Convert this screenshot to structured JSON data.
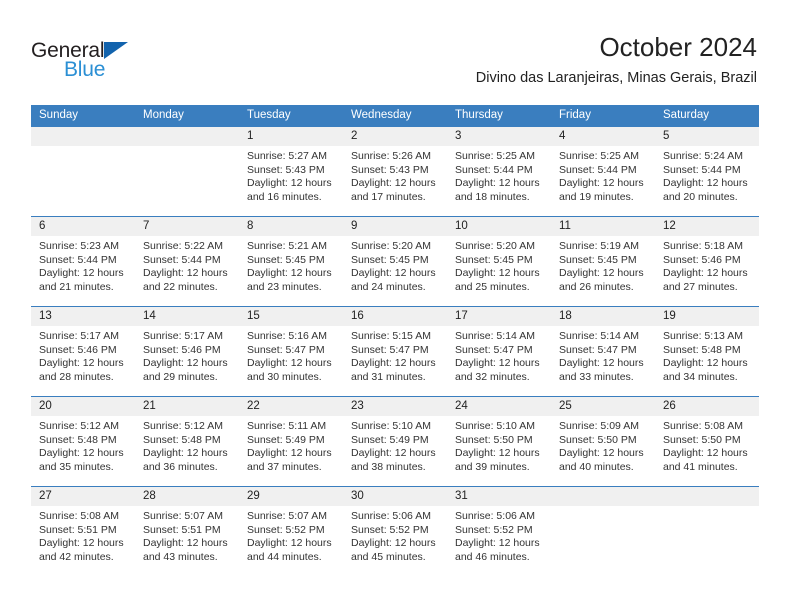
{
  "logo": {
    "word_dark": "General",
    "word_blue": "Blue",
    "triangle_color": "#1263ad",
    "blue_color": "#2b8fd4"
  },
  "header": {
    "title": "October 2024",
    "subtitle": "Divino das Laranjeiras, Minas Gerais, Brazil"
  },
  "theme": {
    "header_blue": "#3a7ebf",
    "band_gray": "#f0f0f0",
    "text": "#333333"
  },
  "calendar": {
    "weekday_headers": [
      "Sunday",
      "Monday",
      "Tuesday",
      "Wednesday",
      "Thursday",
      "Friday",
      "Saturday"
    ],
    "weeks": [
      [
        {
          "day": "",
          "empty": true,
          "sunrise": "",
          "sunset": "",
          "daylight_1": "",
          "daylight_2": ""
        },
        {
          "day": "",
          "empty": true,
          "sunrise": "",
          "sunset": "",
          "daylight_1": "",
          "daylight_2": ""
        },
        {
          "day": "1",
          "sunrise": "Sunrise: 5:27 AM",
          "sunset": "Sunset: 5:43 PM",
          "daylight_1": "Daylight: 12 hours",
          "daylight_2": "and 16 minutes."
        },
        {
          "day": "2",
          "sunrise": "Sunrise: 5:26 AM",
          "sunset": "Sunset: 5:43 PM",
          "daylight_1": "Daylight: 12 hours",
          "daylight_2": "and 17 minutes."
        },
        {
          "day": "3",
          "sunrise": "Sunrise: 5:25 AM",
          "sunset": "Sunset: 5:44 PM",
          "daylight_1": "Daylight: 12 hours",
          "daylight_2": "and 18 minutes."
        },
        {
          "day": "4",
          "sunrise": "Sunrise: 5:25 AM",
          "sunset": "Sunset: 5:44 PM",
          "daylight_1": "Daylight: 12 hours",
          "daylight_2": "and 19 minutes."
        },
        {
          "day": "5",
          "sunrise": "Sunrise: 5:24 AM",
          "sunset": "Sunset: 5:44 PM",
          "daylight_1": "Daylight: 12 hours",
          "daylight_2": "and 20 minutes."
        }
      ],
      [
        {
          "day": "6",
          "sunrise": "Sunrise: 5:23 AM",
          "sunset": "Sunset: 5:44 PM",
          "daylight_1": "Daylight: 12 hours",
          "daylight_2": "and 21 minutes."
        },
        {
          "day": "7",
          "sunrise": "Sunrise: 5:22 AM",
          "sunset": "Sunset: 5:44 PM",
          "daylight_1": "Daylight: 12 hours",
          "daylight_2": "and 22 minutes."
        },
        {
          "day": "8",
          "sunrise": "Sunrise: 5:21 AM",
          "sunset": "Sunset: 5:45 PM",
          "daylight_1": "Daylight: 12 hours",
          "daylight_2": "and 23 minutes."
        },
        {
          "day": "9",
          "sunrise": "Sunrise: 5:20 AM",
          "sunset": "Sunset: 5:45 PM",
          "daylight_1": "Daylight: 12 hours",
          "daylight_2": "and 24 minutes."
        },
        {
          "day": "10",
          "sunrise": "Sunrise: 5:20 AM",
          "sunset": "Sunset: 5:45 PM",
          "daylight_1": "Daylight: 12 hours",
          "daylight_2": "and 25 minutes."
        },
        {
          "day": "11",
          "sunrise": "Sunrise: 5:19 AM",
          "sunset": "Sunset: 5:45 PM",
          "daylight_1": "Daylight: 12 hours",
          "daylight_2": "and 26 minutes."
        },
        {
          "day": "12",
          "sunrise": "Sunrise: 5:18 AM",
          "sunset": "Sunset: 5:46 PM",
          "daylight_1": "Daylight: 12 hours",
          "daylight_2": "and 27 minutes."
        }
      ],
      [
        {
          "day": "13",
          "sunrise": "Sunrise: 5:17 AM",
          "sunset": "Sunset: 5:46 PM",
          "daylight_1": "Daylight: 12 hours",
          "daylight_2": "and 28 minutes."
        },
        {
          "day": "14",
          "sunrise": "Sunrise: 5:17 AM",
          "sunset": "Sunset: 5:46 PM",
          "daylight_1": "Daylight: 12 hours",
          "daylight_2": "and 29 minutes."
        },
        {
          "day": "15",
          "sunrise": "Sunrise: 5:16 AM",
          "sunset": "Sunset: 5:47 PM",
          "daylight_1": "Daylight: 12 hours",
          "daylight_2": "and 30 minutes."
        },
        {
          "day": "16",
          "sunrise": "Sunrise: 5:15 AM",
          "sunset": "Sunset: 5:47 PM",
          "daylight_1": "Daylight: 12 hours",
          "daylight_2": "and 31 minutes."
        },
        {
          "day": "17",
          "sunrise": "Sunrise: 5:14 AM",
          "sunset": "Sunset: 5:47 PM",
          "daylight_1": "Daylight: 12 hours",
          "daylight_2": "and 32 minutes."
        },
        {
          "day": "18",
          "sunrise": "Sunrise: 5:14 AM",
          "sunset": "Sunset: 5:47 PM",
          "daylight_1": "Daylight: 12 hours",
          "daylight_2": "and 33 minutes."
        },
        {
          "day": "19",
          "sunrise": "Sunrise: 5:13 AM",
          "sunset": "Sunset: 5:48 PM",
          "daylight_1": "Daylight: 12 hours",
          "daylight_2": "and 34 minutes."
        }
      ],
      [
        {
          "day": "20",
          "sunrise": "Sunrise: 5:12 AM",
          "sunset": "Sunset: 5:48 PM",
          "daylight_1": "Daylight: 12 hours",
          "daylight_2": "and 35 minutes."
        },
        {
          "day": "21",
          "sunrise": "Sunrise: 5:12 AM",
          "sunset": "Sunset: 5:48 PM",
          "daylight_1": "Daylight: 12 hours",
          "daylight_2": "and 36 minutes."
        },
        {
          "day": "22",
          "sunrise": "Sunrise: 5:11 AM",
          "sunset": "Sunset: 5:49 PM",
          "daylight_1": "Daylight: 12 hours",
          "daylight_2": "and 37 minutes."
        },
        {
          "day": "23",
          "sunrise": "Sunrise: 5:10 AM",
          "sunset": "Sunset: 5:49 PM",
          "daylight_1": "Daylight: 12 hours",
          "daylight_2": "and 38 minutes."
        },
        {
          "day": "24",
          "sunrise": "Sunrise: 5:10 AM",
          "sunset": "Sunset: 5:50 PM",
          "daylight_1": "Daylight: 12 hours",
          "daylight_2": "and 39 minutes."
        },
        {
          "day": "25",
          "sunrise": "Sunrise: 5:09 AM",
          "sunset": "Sunset: 5:50 PM",
          "daylight_1": "Daylight: 12 hours",
          "daylight_2": "and 40 minutes."
        },
        {
          "day": "26",
          "sunrise": "Sunrise: 5:08 AM",
          "sunset": "Sunset: 5:50 PM",
          "daylight_1": "Daylight: 12 hours",
          "daylight_2": "and 41 minutes."
        }
      ],
      [
        {
          "day": "27",
          "sunrise": "Sunrise: 5:08 AM",
          "sunset": "Sunset: 5:51 PM",
          "daylight_1": "Daylight: 12 hours",
          "daylight_2": "and 42 minutes."
        },
        {
          "day": "28",
          "sunrise": "Sunrise: 5:07 AM",
          "sunset": "Sunset: 5:51 PM",
          "daylight_1": "Daylight: 12 hours",
          "daylight_2": "and 43 minutes."
        },
        {
          "day": "29",
          "sunrise": "Sunrise: 5:07 AM",
          "sunset": "Sunset: 5:52 PM",
          "daylight_1": "Daylight: 12 hours",
          "daylight_2": "and 44 minutes."
        },
        {
          "day": "30",
          "sunrise": "Sunrise: 5:06 AM",
          "sunset": "Sunset: 5:52 PM",
          "daylight_1": "Daylight: 12 hours",
          "daylight_2": "and 45 minutes."
        },
        {
          "day": "31",
          "sunrise": "Sunrise: 5:06 AM",
          "sunset": "Sunset: 5:52 PM",
          "daylight_1": "Daylight: 12 hours",
          "daylight_2": "and 46 minutes."
        },
        {
          "day": "",
          "empty": true,
          "sunrise": "",
          "sunset": "",
          "daylight_1": "",
          "daylight_2": ""
        },
        {
          "day": "",
          "empty": true,
          "sunrise": "",
          "sunset": "",
          "daylight_1": "",
          "daylight_2": ""
        }
      ]
    ]
  }
}
